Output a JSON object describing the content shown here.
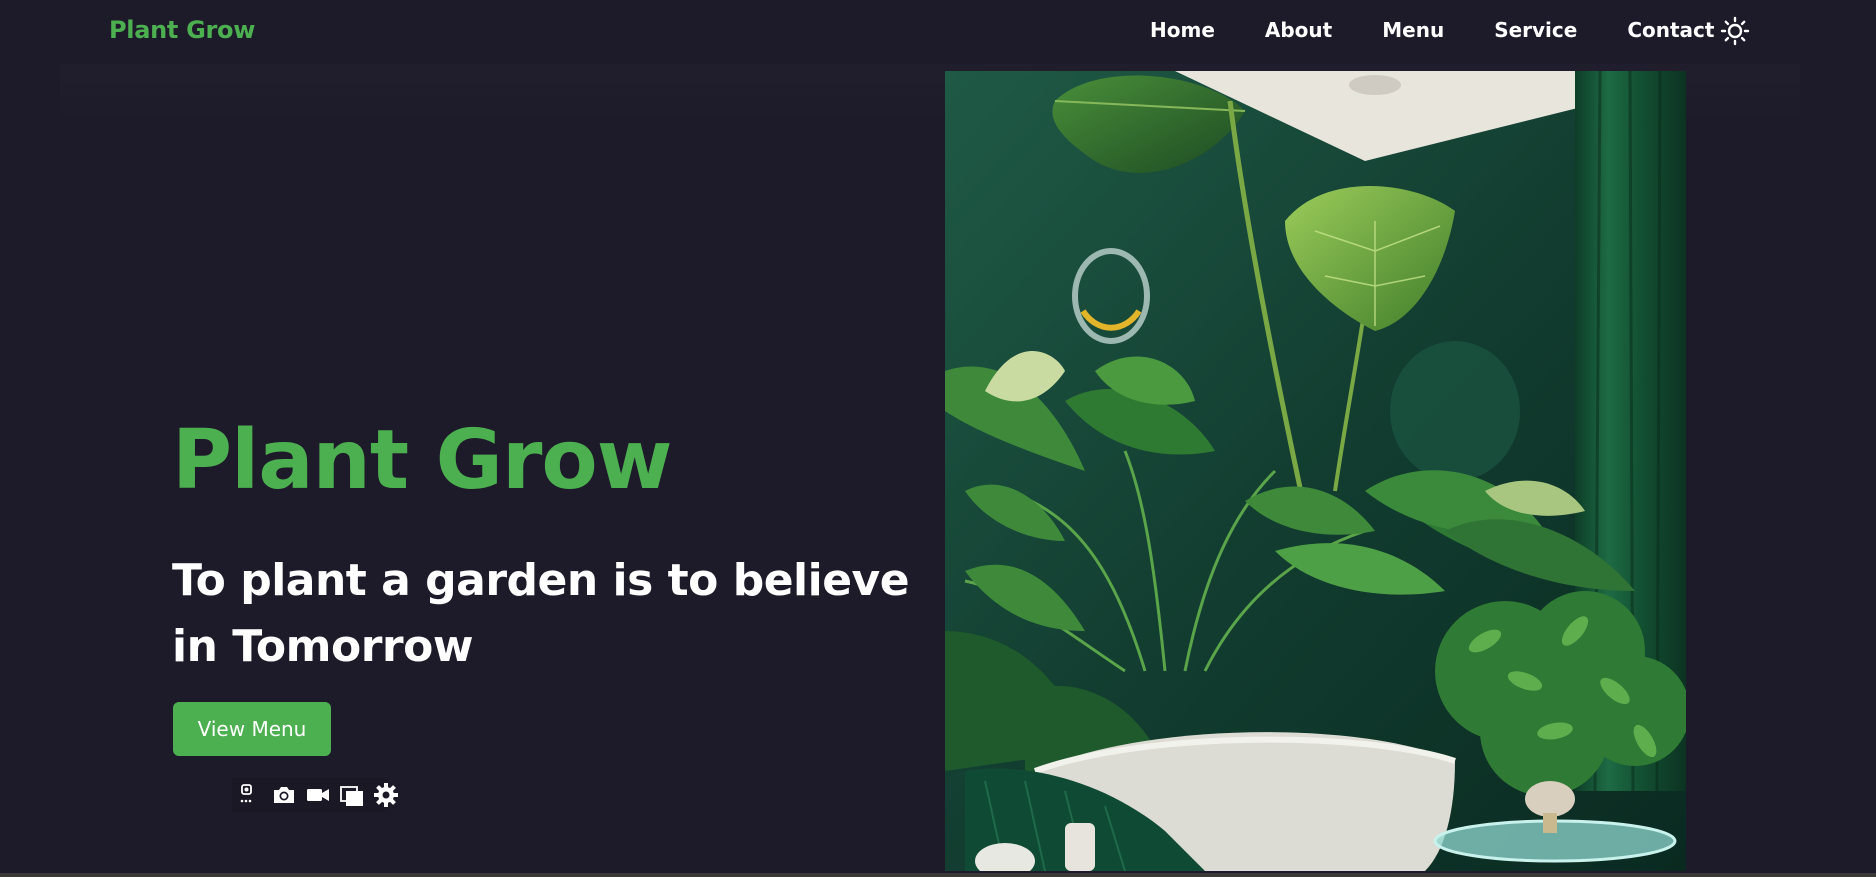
{
  "navbar": {
    "brand": "Plant Grow",
    "links": [
      {
        "label": "Home"
      },
      {
        "label": "About"
      },
      {
        "label": "Menu"
      },
      {
        "label": "Service"
      },
      {
        "label": "Contact"
      }
    ],
    "theme_icon": "sun-icon"
  },
  "hero": {
    "title": "Plant Grow",
    "tagline": "To plant a garden is to believe in Tomorrow",
    "button_label": "View Menu",
    "image_icon": "indoor-plants-photo"
  },
  "toolbar": {
    "icons": [
      "screenshot-options-icon",
      "camera-icon",
      "video-icon",
      "windows-icon",
      "gear-icon"
    ]
  },
  "colors": {
    "background": "#1d1b29",
    "accent": "#4caf50",
    "text": "#ffffff"
  }
}
